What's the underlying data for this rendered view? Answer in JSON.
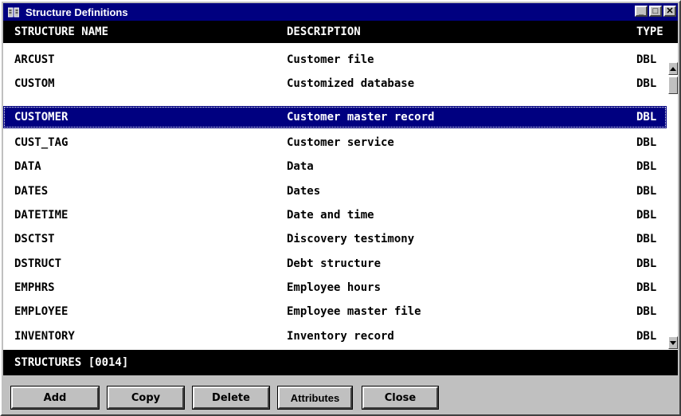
{
  "window": {
    "title": "Structure Definitions",
    "minimize_label": "_",
    "maximize_label": "□",
    "close_label": "✕"
  },
  "header": {
    "name": "STRUCTURE NAME",
    "description": "DESCRIPTION",
    "type": "TYPE"
  },
  "rows": [
    {
      "name": "ARCUST",
      "description": "Customer file",
      "type": "DBL"
    },
    {
      "name": "CUSTOM",
      "description": "Customized database",
      "type": "DBL"
    },
    {
      "name": "CUSTOMER",
      "description": "Customer master record",
      "type": "DBL"
    },
    {
      "name": "CUST_TAG",
      "description": "Customer service",
      "type": "DBL"
    },
    {
      "name": "DATA",
      "description": "Data",
      "type": "DBL"
    },
    {
      "name": "DATES",
      "description": "Dates",
      "type": "DBL"
    },
    {
      "name": "DATETIME",
      "description": "Date and time",
      "type": "DBL"
    },
    {
      "name": "DSCTST",
      "description": "Discovery testimony",
      "type": "DBL"
    },
    {
      "name": "DSTRUCT",
      "description": "Debt structure",
      "type": "DBL"
    },
    {
      "name": "EMPHRS",
      "description": "Employee hours",
      "type": "DBL"
    },
    {
      "name": "EMPLOYEE",
      "description": "Employee master file",
      "type": "DBL"
    },
    {
      "name": "INVENTORY",
      "description": "Inventory record",
      "type": "DBL"
    }
  ],
  "selected_index": 2,
  "status": {
    "text": "STRUCTURES [0014]"
  },
  "buttons": {
    "add": "Add",
    "copy": "Copy",
    "delete": "Delete",
    "attributes": "Attributes",
    "close": "Close"
  },
  "colors": {
    "titlebar": "#000080",
    "selection": "#000080",
    "header_bg": "#000000",
    "face": "#c0c0c0"
  },
  "icons": {
    "app": "book-icon",
    "scroll_up": "arrow-up-icon",
    "scroll_down": "arrow-down-icon"
  }
}
